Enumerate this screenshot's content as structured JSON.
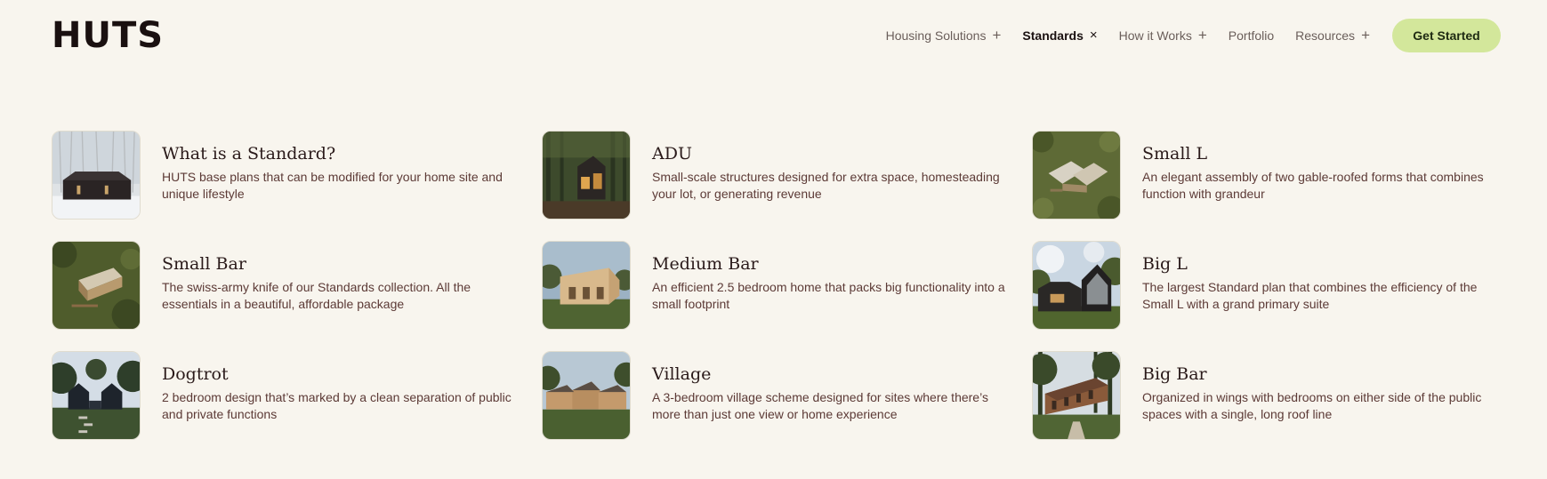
{
  "brand": {
    "logo": "HUTS"
  },
  "nav": {
    "items": [
      {
        "label": "Housing Solutions",
        "symbol": "+",
        "active": false
      },
      {
        "label": "Standards",
        "symbol": "×",
        "active": true
      },
      {
        "label": "How it Works",
        "symbol": "+",
        "active": false
      },
      {
        "label": "Portfolio",
        "symbol": "",
        "active": false
      },
      {
        "label": "Resources",
        "symbol": "+",
        "active": false
      }
    ],
    "cta": "Get Started"
  },
  "standards": [
    {
      "title": "What is a Standard?",
      "description": "HUTS base plans that can be modified for your home site and unique lifestyle",
      "thumb": "snow-scene"
    },
    {
      "title": "ADU",
      "description": "Small-scale structures designed for extra space, homesteading your lot, or generating revenue",
      "thumb": "forest-cabin"
    },
    {
      "title": "Small L",
      "description": "An elegant assembly of two gable-roofed forms that combines function with grandeur",
      "thumb": "aerial-l"
    },
    {
      "title": "Small Bar",
      "description": "The swiss-army knife of our Standards collection. All the essentials in a beautiful, affordable package",
      "thumb": "aerial-bar"
    },
    {
      "title": "Medium Bar",
      "description": "An efficient 2.5 bedroom home that packs big functionality into a small footprint",
      "thumb": "meadow-bar"
    },
    {
      "title": "Big L",
      "description": "The largest Standard plan that combines the efficiency of the Small L with a grand primary suite",
      "thumb": "dark-gable"
    },
    {
      "title": "Dogtrot",
      "description": "2 bedroom design that’s marked by a clean separation of public and private functions",
      "thumb": "twin-gables"
    },
    {
      "title": "Village",
      "description": "A 3-bedroom village scheme designed for sites where there’s more than just one view or home experience",
      "thumb": "village"
    },
    {
      "title": "Big Bar",
      "description": "Organized in wings with bedrooms on either side of the public spaces with a single, long roof line",
      "thumb": "long-bar"
    }
  ]
}
